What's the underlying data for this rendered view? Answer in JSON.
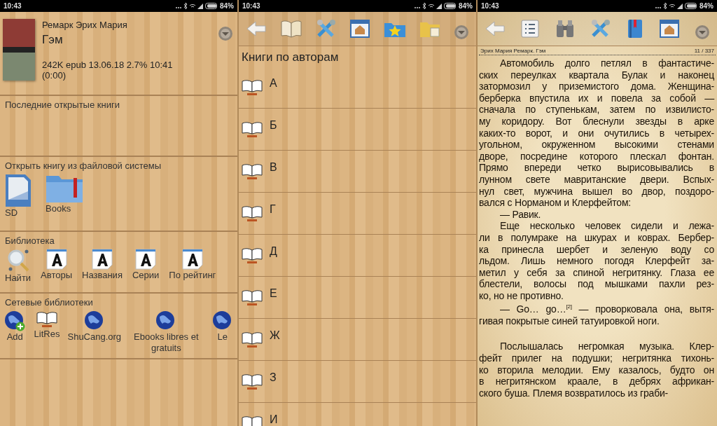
{
  "home_screen": {
    "status_bar": {
      "time": "10:43",
      "battery": "84%"
    },
    "current_book": {
      "author": "Ремарк Эрих Мария",
      "title": "Гэм",
      "info": "242K epub 13.06.18  2.7% 10:41 (0:00)"
    },
    "recent_books": {
      "title": "Последние открытые книги"
    },
    "file_system": {
      "title": "Открыть книгу из файловой системы",
      "items": [
        {
          "label": "SD",
          "kind": "sd"
        },
        {
          "label": "Books",
          "kind": "folder"
        }
      ]
    },
    "library": {
      "title": "Библиотека",
      "items": [
        {
          "label": "Найти",
          "kind": "search"
        },
        {
          "label": "Авторы",
          "kind": "letter"
        },
        {
          "label": "Названия",
          "kind": "letter"
        },
        {
          "label": "Серии",
          "kind": "letter"
        },
        {
          "label": "По рейтинг",
          "kind": "letter"
        }
      ]
    },
    "network_libraries": {
      "title": "Сетевые библиотеки",
      "items": [
        {
          "label": "Add",
          "kind": "globe-add"
        },
        {
          "label": "LitRes",
          "kind": "book"
        },
        {
          "label": "ShuCang.org",
          "kind": "globe"
        },
        {
          "label": "Ebooks libres et gratuits",
          "kind": "globe"
        },
        {
          "label": "Le",
          "kind": "globe"
        }
      ]
    }
  },
  "authors_screen": {
    "status_bar": {
      "time": "10:43",
      "battery": "84%"
    },
    "toolbar": [
      {
        "kind": "back"
      },
      {
        "kind": "book"
      },
      {
        "kind": "tools"
      },
      {
        "kind": "home"
      },
      {
        "kind": "star-folder"
      },
      {
        "kind": "folder"
      },
      {
        "kind": "dropdown"
      }
    ],
    "title": "Книги по авторам",
    "letters": [
      "А",
      "Б",
      "В",
      "Г",
      "Д",
      "Е",
      "Ж",
      "З",
      "И"
    ]
  },
  "reader_screen": {
    "status_bar": {
      "time": "10:43",
      "battery": "84%"
    },
    "toolbar": [
      {
        "kind": "back"
      },
      {
        "kind": "list"
      },
      {
        "kind": "binoculars"
      },
      {
        "kind": "tools"
      },
      {
        "kind": "bookmark"
      },
      {
        "kind": "home"
      },
      {
        "kind": "dropdown"
      }
    ],
    "header": {
      "title": "Эрих Мария Ремарк.  Гэм",
      "page": "11 / 337"
    },
    "sections": [
      {
        "paragraphs": [
          {
            "lines": [
              "Автомобиль долго петлял в фантастиче-",
              "ских переулках квартала Булак и наконец",
              "затормозил у приземистого дома. Женщина-",
              "берберка впустила их и повела за собой —",
              "сначала по ступенькам, затем по извилисто-",
              "му коридору. Вот блеснули звезды в арке",
              "каких-то ворот, и они очутились в четырех-",
              "угольном, окруженном высокими стенами",
              "дворе, посредине которого плескал фонтан.",
              "Прямо впереди четко вырисовывались в",
              "лунном свете мавританские двери. Вспых-",
              "нул свет, мужчина вышел во двор, поздоро-",
              "вался с Норманом и Клерфейтом:"
            ]
          },
          {
            "lines": [
              "— Равик."
            ]
          },
          {
            "lines": [
              "Еще несколько человек сидели и лежа-",
              "ли в полумраке на шкурах и коврах. Бербер-",
              "ка принесла шербет и зеленую воду со",
              "льдом. Лишь немного погодя Клерфейт за-",
              "метил у себя за спиной негритянку. Глаза ее",
              "блестели, волосы под мышками пахли рез-",
              "ко, но не противно."
            ]
          },
          {
            "lines": [
              "— Go… go…$^{[2]}$ — проворковала она, вытя-",
              "гивая покрытые синей татуировкой ноги."
            ]
          }
        ]
      },
      {
        "paragraphs": [
          {
            "lines": [
              "Послышалась негромкая музыка. Клер-",
              "фейт прилег на подушки; негритянка тихонь-",
              "ко вторила мелодии. Ему казалось, будто он",
              "в негритянском краале, в дебрях африкан-",
              "ского буша. Племя возвратилось из граби-"
            ]
          }
        ]
      }
    ]
  }
}
